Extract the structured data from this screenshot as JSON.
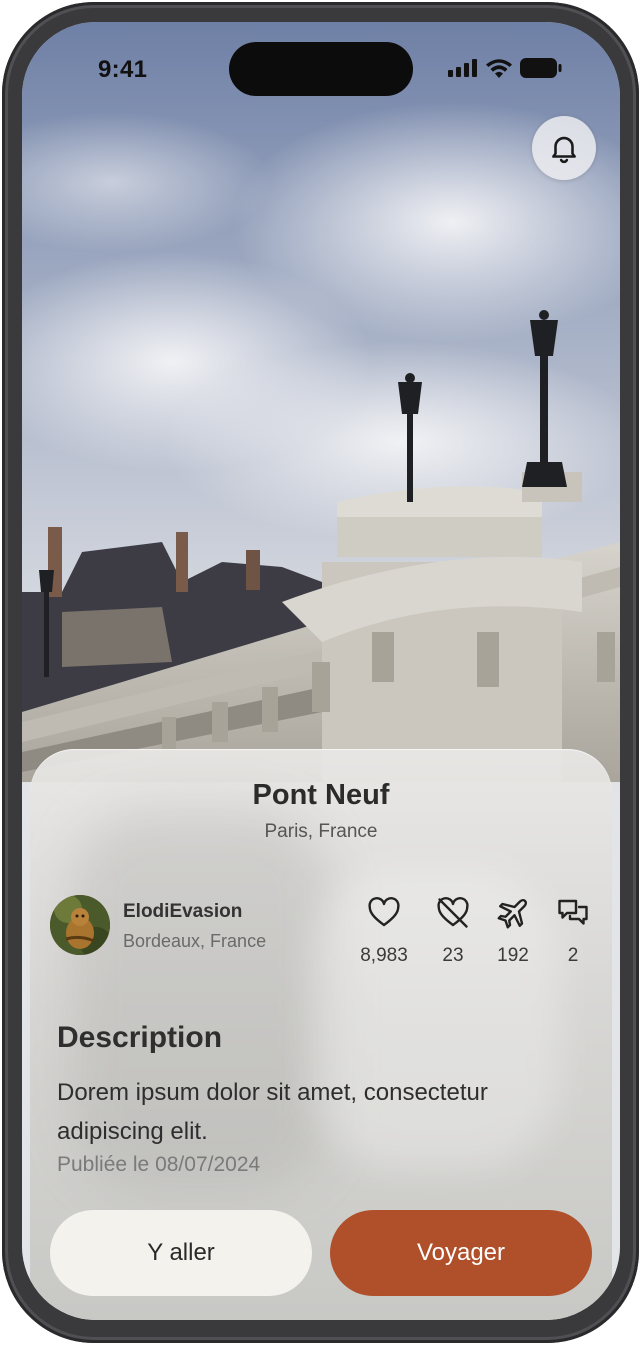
{
  "status_bar": {
    "time": "9:41"
  },
  "place": {
    "title": "Pont Neuf",
    "location": "Paris, France"
  },
  "author": {
    "name": "ElodiEvasion",
    "location": "Bordeaux, France"
  },
  "stats": [
    {
      "icon": "heart-icon",
      "count": "8,983"
    },
    {
      "icon": "heart-off-icon",
      "count": "23"
    },
    {
      "icon": "plane-icon",
      "count": "192"
    },
    {
      "icon": "comments-icon",
      "count": "2"
    }
  ],
  "description": {
    "title": "Description",
    "text": "Dorem ipsum dolor sit amet, consectetur adipiscing elit.",
    "published": "Publiée le 08/07/2024"
  },
  "actions": {
    "go_label": "Y aller",
    "travel_label": "Voyager"
  },
  "colors": {
    "accent": "#b0502a",
    "secondary_button": "#f3f2ec"
  }
}
